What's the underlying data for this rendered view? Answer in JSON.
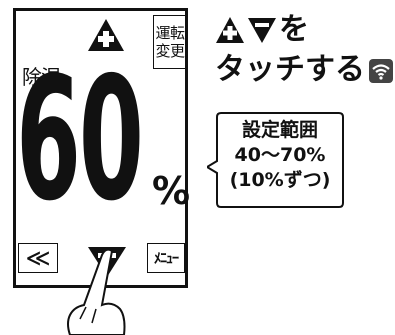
{
  "panel": {
    "mode_button": {
      "line1": "運転",
      "line2": "変更"
    },
    "mode_label": "除湿",
    "humidity_value": "60",
    "humidity_unit": "%",
    "back_button": "≪",
    "menu_button": "ﾒﾆｭｰ"
  },
  "instruction": {
    "line1_suffix": "を",
    "line2": "タッチする"
  },
  "callout": {
    "line1": "設定範囲",
    "line2": "40〜70%",
    "line3": "(10%ずつ)"
  },
  "icons": [
    "up-icon",
    "down-icon",
    "wifi-icon",
    "hand-pointer-icon"
  ]
}
